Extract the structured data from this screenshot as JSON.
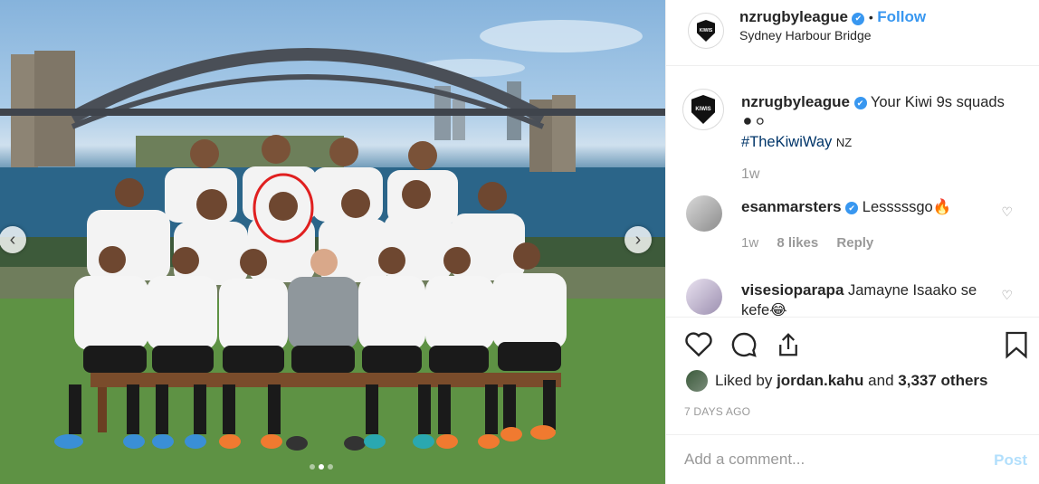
{
  "post": {
    "username": "nzrugbyleague",
    "follow_label": "Follow",
    "separator": "•",
    "location": "Sydney Harbour Bridge",
    "logo_text": "KIWIS"
  },
  "caption": {
    "username": "nzrugbyleague",
    "text": "Your Kiwi 9s squads",
    "emoji": "⚫⚪",
    "hashtag": "#TheKiwiWay",
    "flag": "NZ",
    "time": "1w"
  },
  "comments": [
    {
      "username": "esanmarsters",
      "text": "Lesssssgo",
      "emoji": "🔥",
      "time": "1w",
      "likes": "8 likes",
      "reply": "Reply"
    },
    {
      "username": "visesioparapa",
      "text": "Jamayne Isaako se kefe",
      "emoji": "😂"
    }
  ],
  "engagement": {
    "liked_prefix": "Liked by",
    "liked_user": "jordan.kahu",
    "liked_mid": "and",
    "liked_others": "3,337 others",
    "posted_ago": "7 DAYS AGO"
  },
  "comment_box": {
    "placeholder": "Add a comment...",
    "post_label": "Post"
  },
  "icons": {
    "heart": "heart-icon",
    "comment": "comment-icon",
    "share": "share-icon",
    "save": "bookmark-icon",
    "prev": "chevron-left-icon",
    "next": "chevron-right-icon",
    "verified": "verified-icon"
  },
  "colors": {
    "link": "#3897f0",
    "hashtag": "#003569",
    "muted": "#999999",
    "highlight_circle": "#e02020"
  },
  "carousel": {
    "slide_count": 3,
    "active_slide": 2
  }
}
